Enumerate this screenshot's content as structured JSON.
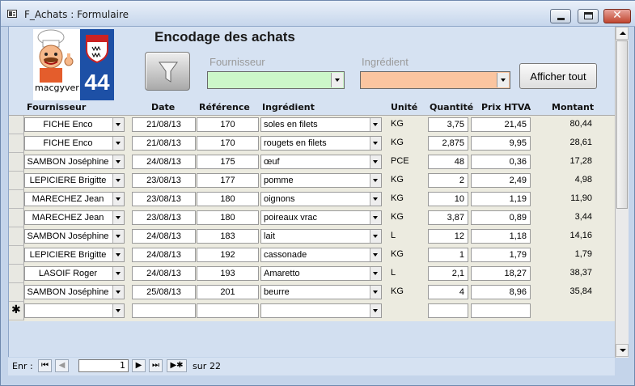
{
  "window": {
    "title": "F_Achats : Formulaire"
  },
  "logo": {
    "label": "macgyver",
    "badge_number": "44"
  },
  "form": {
    "heading": "Encodage des achats",
    "filter_fournisseur_label": "Fournisseur",
    "filter_ingredient_label": "Ingrédient",
    "filter_fournisseur_value": "",
    "filter_ingredient_value": "",
    "show_all_label": "Afficher tout",
    "colors": {
      "fournisseur_filter": "#ccf7c9",
      "ingredient_filter": "#fbc5a0"
    }
  },
  "columns": {
    "fournisseur": "Fournisseur",
    "date": "Date",
    "reference": "Référence",
    "ingredient": "Ingrédient",
    "unite": "Unité",
    "quantite": "Quantité",
    "prix": "Prix HTVA",
    "montant": "Montant"
  },
  "rows": [
    {
      "fournisseur": "FICHE Enco",
      "date": "21/08/13",
      "reference": "170",
      "ingredient": "soles en filets",
      "unite": "KG",
      "quantite": "3,75",
      "prix": "21,45",
      "montant": "80,44"
    },
    {
      "fournisseur": "FICHE Enco",
      "date": "21/08/13",
      "reference": "170",
      "ingredient": "rougets en filets",
      "unite": "KG",
      "quantite": "2,875",
      "prix": "9,95",
      "montant": "28,61"
    },
    {
      "fournisseur": "SAMBON Joséphine",
      "date": "24/08/13",
      "reference": "175",
      "ingredient": "œuf",
      "unite": "PCE",
      "quantite": "48",
      "prix": "0,36",
      "montant": "17,28"
    },
    {
      "fournisseur": "LEPICIERE Brigitte",
      "date": "23/08/13",
      "reference": "177",
      "ingredient": "pomme",
      "unite": "KG",
      "quantite": "2",
      "prix": "2,49",
      "montant": "4,98"
    },
    {
      "fournisseur": "MARECHEZ Jean",
      "date": "23/08/13",
      "reference": "180",
      "ingredient": "oignons",
      "unite": "KG",
      "quantite": "10",
      "prix": "1,19",
      "montant": "11,90"
    },
    {
      "fournisseur": "MARECHEZ Jean",
      "date": "23/08/13",
      "reference": "180",
      "ingredient": "poireaux vrac",
      "unite": "KG",
      "quantite": "3,87",
      "prix": "0,89",
      "montant": "3,44"
    },
    {
      "fournisseur": "SAMBON Joséphine",
      "date": "24/08/13",
      "reference": "183",
      "ingredient": "lait",
      "unite": "L",
      "quantite": "12",
      "prix": "1,18",
      "montant": "14,16"
    },
    {
      "fournisseur": "LEPICIERE Brigitte",
      "date": "24/08/13",
      "reference": "192",
      "ingredient": "cassonade",
      "unite": "KG",
      "quantite": "1",
      "prix": "1,79",
      "montant": "1,79"
    },
    {
      "fournisseur": "LASOIF Roger",
      "date": "24/08/13",
      "reference": "193",
      "ingredient": "Amaretto",
      "unite": "L",
      "quantite": "2,1",
      "prix": "18,27",
      "montant": "38,37"
    },
    {
      "fournisseur": "SAMBON Joséphine",
      "date": "25/08/13",
      "reference": "201",
      "ingredient": "beurre",
      "unite": "KG",
      "quantite": "4",
      "prix": "8,96",
      "montant": "35,84"
    }
  ],
  "new_row_marker": "✱",
  "navigation": {
    "label": "Enr :",
    "current": "1",
    "of_label": "sur",
    "total": "22"
  }
}
